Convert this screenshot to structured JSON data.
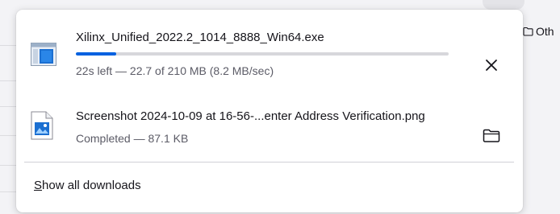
{
  "background": {
    "bookmark_label": "Oth"
  },
  "downloads": [
    {
      "filename": "Xilinx_Unified_2022.2_1014_8888_Win64.exe",
      "status": "22s left — 22.7 of 210 MB (8.2 MB/sec)",
      "progress": 0.108,
      "icon": "exe-window-icon",
      "action": "cancel-icon"
    },
    {
      "filename": "Screenshot 2024-10-09 at 16-56-...enter Address Verification.png",
      "status": "Completed — 87.1 KB",
      "icon": "png-image-file-icon",
      "action": "folder-icon"
    }
  ],
  "footer": {
    "show_all_mnemonic": "S",
    "show_all_rest": "how all downloads"
  },
  "colors": {
    "accent": "#0061e0",
    "muted_text": "#5b5b66"
  }
}
